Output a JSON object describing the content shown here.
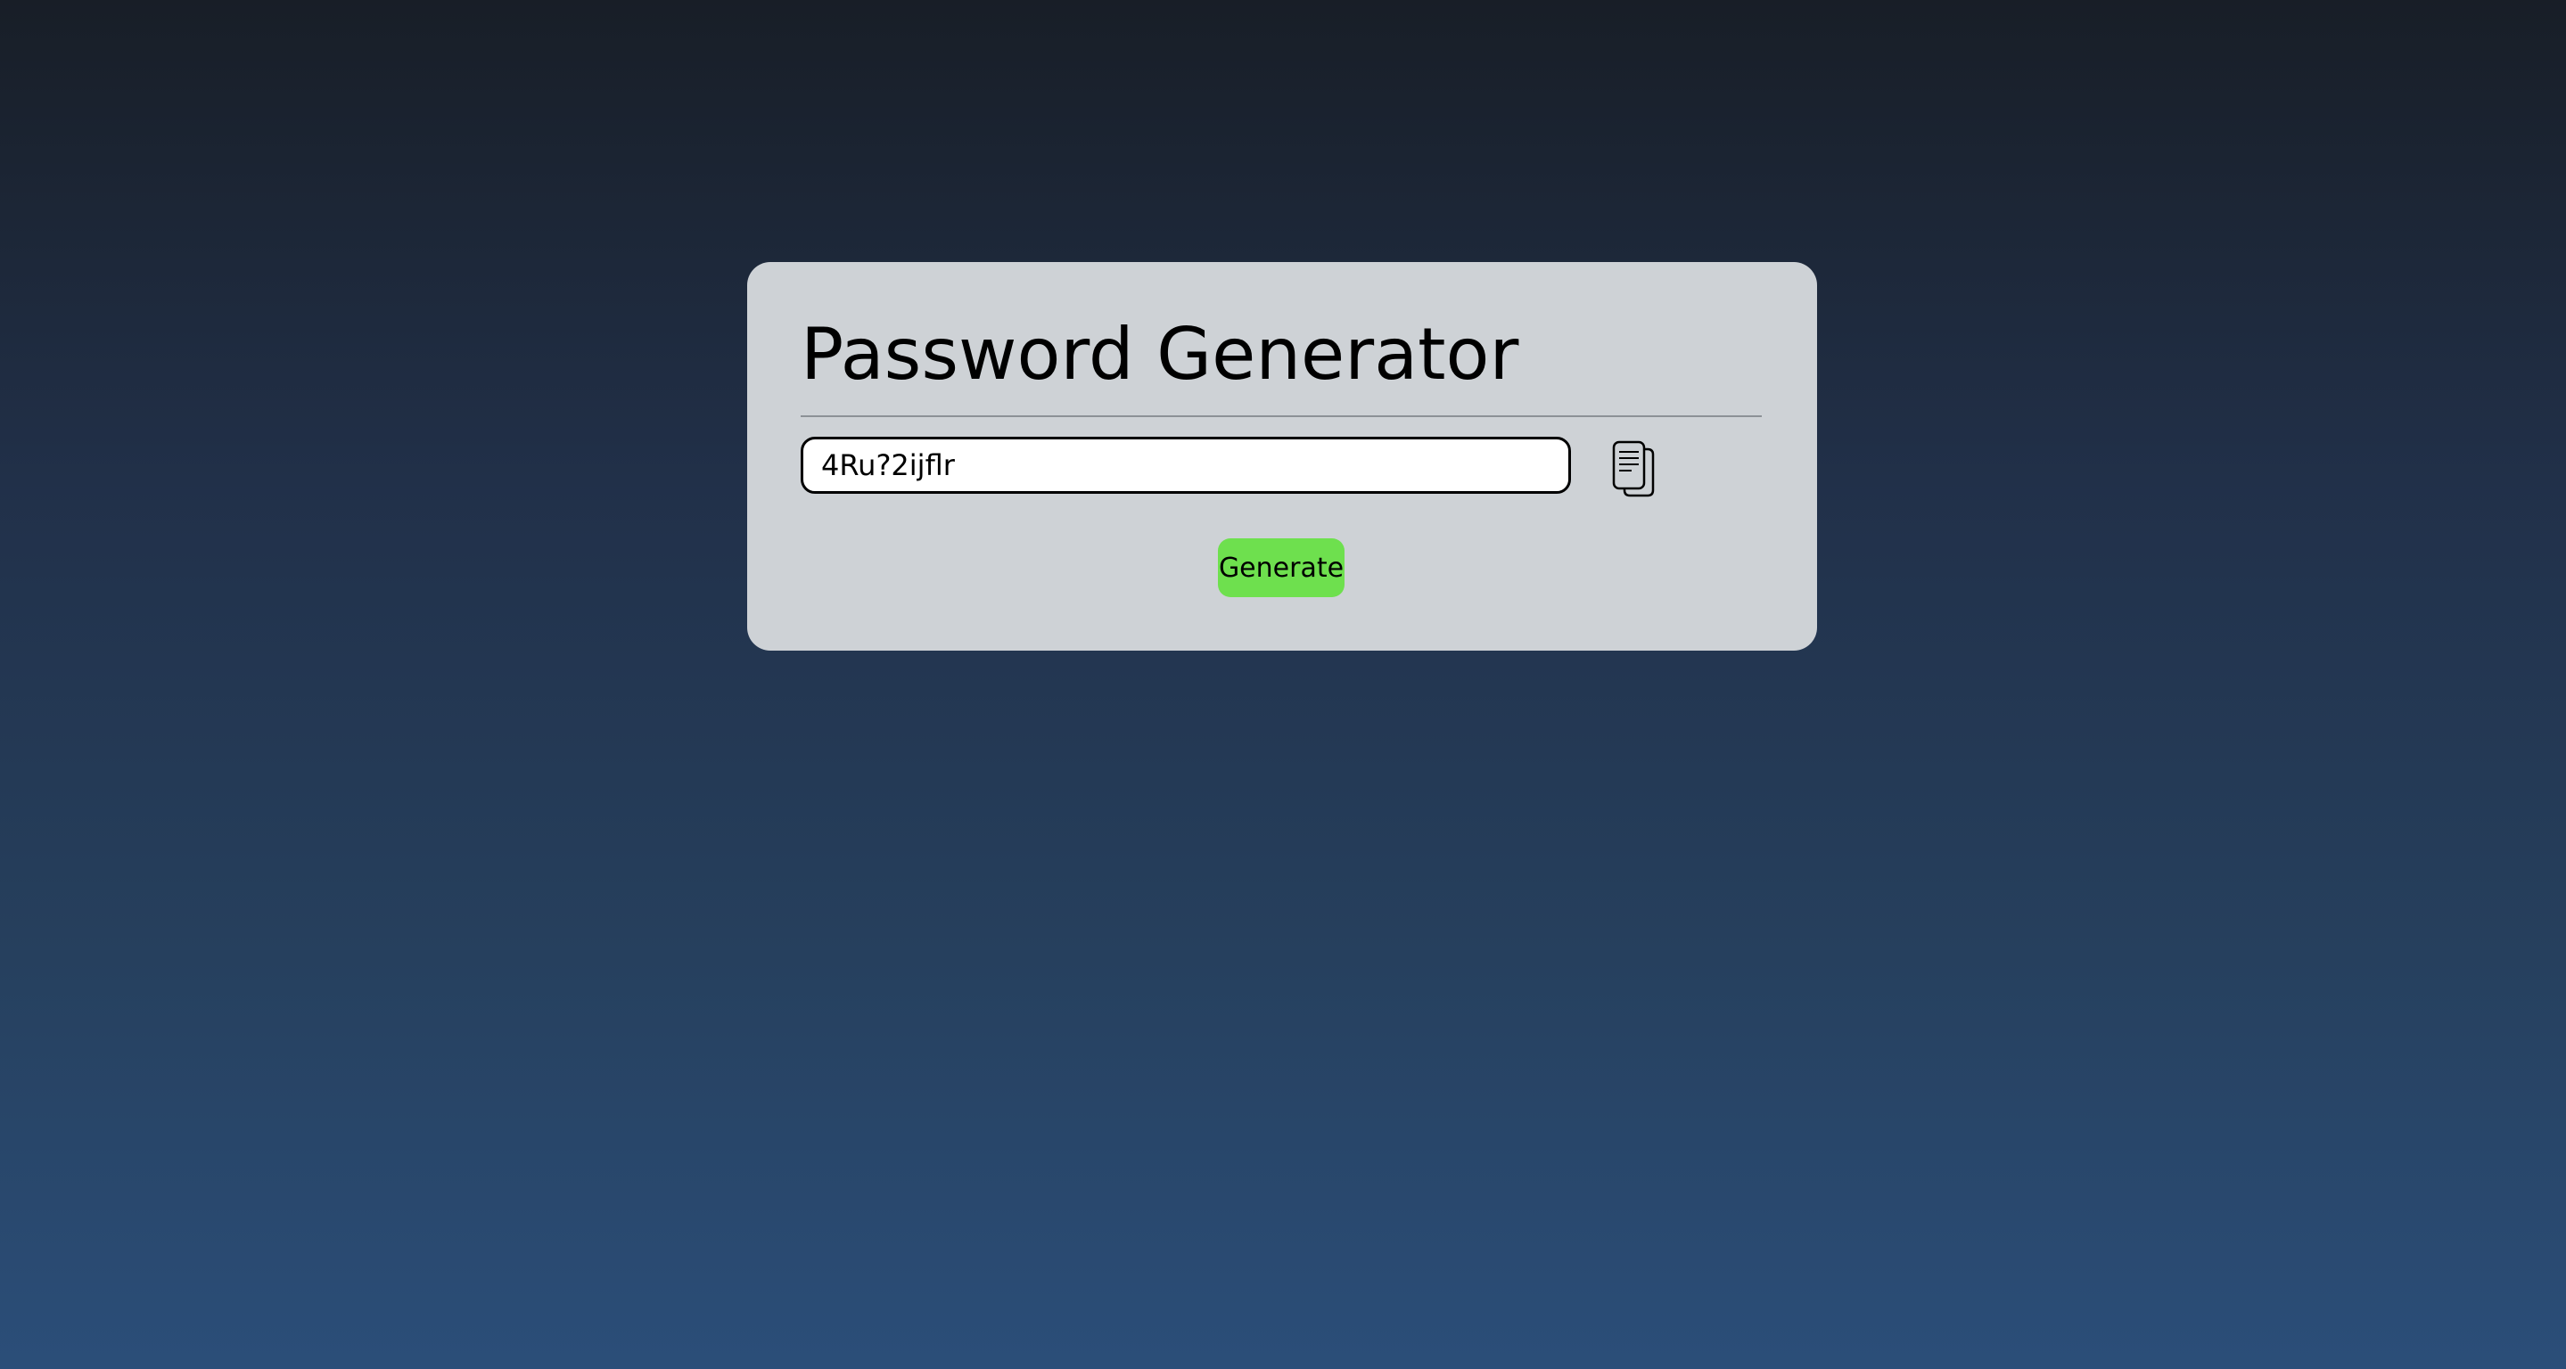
{
  "page": {
    "title": "Password Generator"
  },
  "password": {
    "value": "4Ru?2ijflr"
  },
  "actions": {
    "copy_icon": "copy-documents-icon",
    "generate_label": "Generate"
  },
  "colors": {
    "card_background": "#ced2d6",
    "generate_button": "#6ee04e",
    "background_top": "#181e27",
    "background_bottom": "#2b4e79"
  }
}
